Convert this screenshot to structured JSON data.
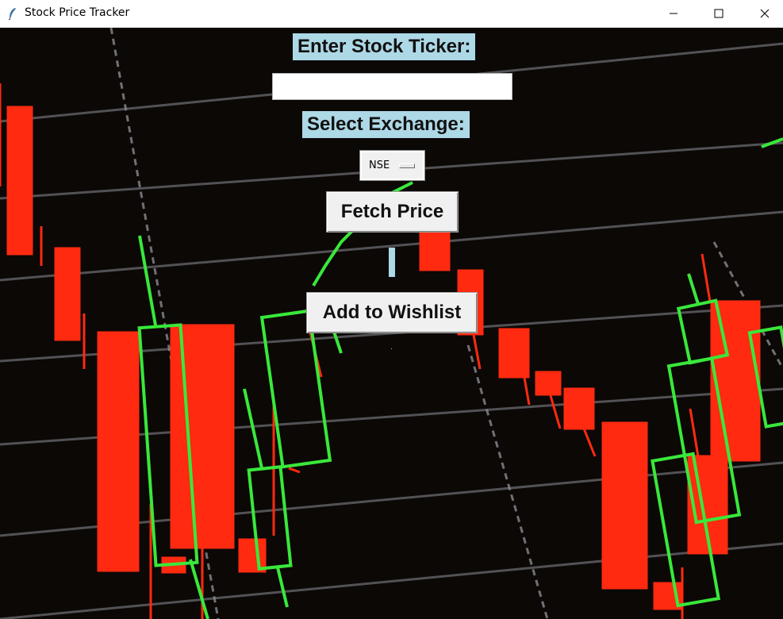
{
  "window": {
    "title": "Stock Price Tracker",
    "icons": {
      "app": "feather-icon",
      "minimize": "minimize-icon",
      "maximize": "maximize-icon",
      "close": "close-icon"
    }
  },
  "form": {
    "ticker_label": "Enter Stock Ticker:",
    "ticker_value": "",
    "exchange_label": "Select Exchange:",
    "exchange_selected": "NSE",
    "fetch_button": "Fetch Price",
    "price_result": "",
    "wishlist_button": "Add to Wishlist",
    "wishlist_status": ""
  },
  "colors": {
    "label_bg": "#add8e6",
    "button_bg": "#f0f0f0",
    "candle_up": "#39e83a",
    "candle_down": "#ff2a10",
    "chart_bg": "#0b0806"
  }
}
